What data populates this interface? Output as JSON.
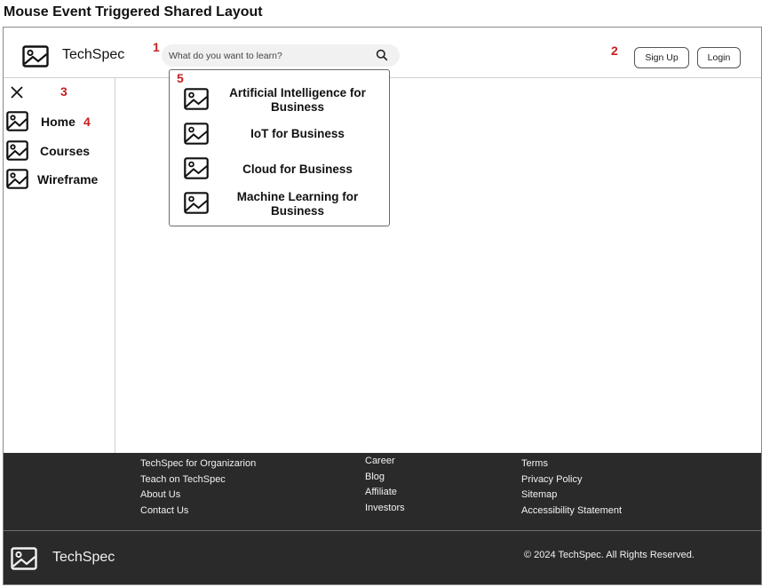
{
  "page_title": "Mouse Event Triggered Shared Layout",
  "header": {
    "brand": "TechSpec",
    "search_placeholder": "What do you want to learn?",
    "signup_label": "Sign Up",
    "login_label": "Login"
  },
  "markers": {
    "m1": "1",
    "m2": "2",
    "m3": "3",
    "m4": "4",
    "m5": "5"
  },
  "sidebar": {
    "items": [
      {
        "label": "Home",
        "icon": "image-icon"
      },
      {
        "label": "Courses",
        "icon": "image-icon"
      },
      {
        "label": "Wireframe",
        "icon": "image-icon"
      }
    ]
  },
  "dropdown": {
    "items": [
      {
        "label": "Artificial Intelligence for Business",
        "icon": "image-icon"
      },
      {
        "label": "IoT for Business",
        "icon": "image-icon"
      },
      {
        "label": "Cloud for Business",
        "icon": "image-icon"
      },
      {
        "label": "Machine Learning for Business",
        "icon": "image-icon"
      }
    ]
  },
  "footer": {
    "col1": [
      "TechSpec for Organizarion",
      "Teach on TechSpec",
      "About Us",
      "Contact Us"
    ],
    "col2": [
      "Career",
      "Blog",
      "Affiliate",
      "Investors"
    ],
    "col3": [
      "Terms",
      "Privacy Policy",
      "Sitemap",
      "Accessibility Statement"
    ],
    "brand": "TechSpec",
    "copyright": "© 2024 TechSpec. All Rights Reserved."
  },
  "colors": {
    "marker": "#c81e1e",
    "footer_bg": "#2a2a2a",
    "search_bg": "#f1f1f1"
  }
}
